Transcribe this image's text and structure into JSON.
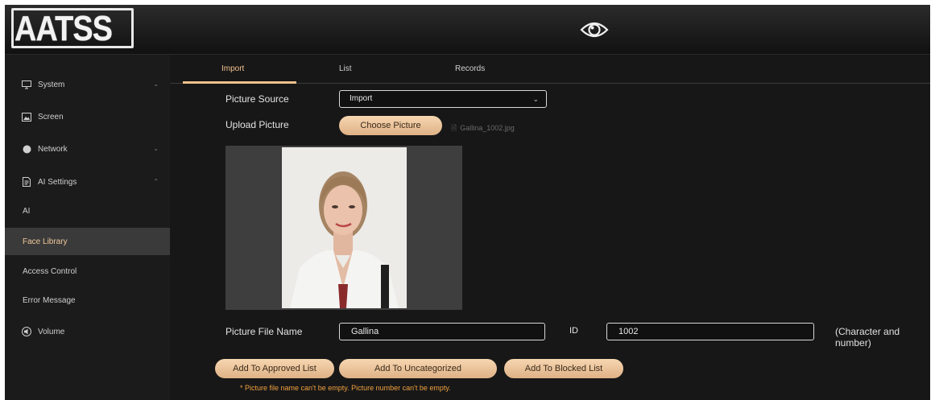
{
  "header": {
    "logo_text": "AATSS",
    "eye_icon": "eye-icon"
  },
  "sidebar": {
    "items": [
      {
        "label": "System",
        "icon": "monitor-icon",
        "expandable": true
      },
      {
        "label": "Screen",
        "icon": "image-icon",
        "expandable": false
      },
      {
        "label": "Network",
        "icon": "globe-icon",
        "expandable": true
      },
      {
        "label": "AI Settings",
        "icon": "document-icon",
        "expandable": true,
        "expanded": true
      },
      {
        "label": "Volume",
        "icon": "speaker-icon",
        "expandable": false
      }
    ],
    "sub_items": [
      {
        "label": "AI"
      },
      {
        "label": "Face Library",
        "active": true
      },
      {
        "label": "Access Control"
      },
      {
        "label": "Error Message"
      }
    ]
  },
  "tabs": [
    {
      "label": "Import",
      "active": true
    },
    {
      "label": "List"
    },
    {
      "label": "Records"
    }
  ],
  "form": {
    "picture_source_label": "Picture Source",
    "picture_source_value": "Import",
    "upload_picture_label": "Upload Picture",
    "choose_picture_button": "Choose Picture",
    "selected_file": "Gallina_1002.jpg",
    "picture_file_name_label": "Picture File Name",
    "picture_file_name_value": "Gallina",
    "id_label": "ID",
    "id_value": "1002",
    "id_hint": "(Character and number)"
  },
  "actions": {
    "add_approved": "Add To Approved List",
    "add_uncategorized": "Add To Uncategorized",
    "add_blocked": "Add To Blocked List"
  },
  "warning": "* Picture file name can't be empty. Picture number can't be empty.",
  "colors": {
    "accent": "#f0c08a",
    "background": "#171717",
    "sidebar": "#1b1b1b",
    "active_item": "#3a3a3a",
    "warning": "#f0a040"
  }
}
